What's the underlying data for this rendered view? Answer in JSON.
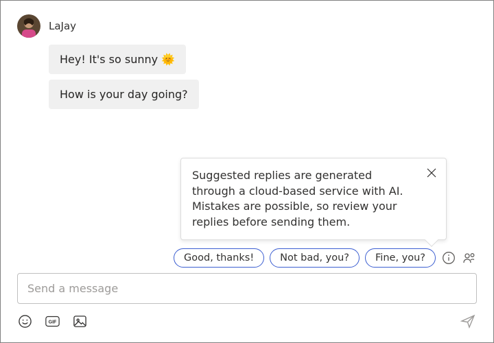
{
  "sender": {
    "name": "LaJay"
  },
  "messages": [
    {
      "text": "Hey! It's so sunny 🌞"
    },
    {
      "text": "How is your day going?"
    }
  ],
  "tooltip": {
    "text": "Suggested replies are generated through a cloud-based service with AI. Mistakes are possible, so review your replies before sending them."
  },
  "suggestions": [
    {
      "label": "Good, thanks!"
    },
    {
      "label": "Not bad, you?"
    },
    {
      "label": "Fine, you?"
    }
  ],
  "compose": {
    "placeholder": "Send a message"
  }
}
